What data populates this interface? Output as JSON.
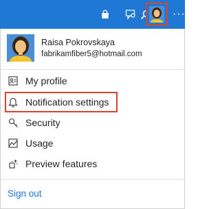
{
  "topbar": {
    "icons": [
      "search-icon",
      "shopping-bag-icon",
      "feedback-icon",
      "avatar",
      "more-icon"
    ],
    "more_glyph": "···"
  },
  "profile": {
    "name": "Raisa Pokrovskaya",
    "email": "fabrikamfiber5@hotmail.com"
  },
  "menu": {
    "items": [
      {
        "label": "My profile",
        "icon": "id-card-icon"
      },
      {
        "label": "Notification settings",
        "icon": "bell-icon"
      },
      {
        "label": "Security",
        "icon": "key-icon"
      },
      {
        "label": "Usage",
        "icon": "usage-icon"
      },
      {
        "label": "Preview features",
        "icon": "preview-features-icon"
      }
    ],
    "sign_out": "Sign out"
  },
  "colors": {
    "topbar_bg": "#1e78d4",
    "highlight_border": "#d9422b",
    "link": "#1e78d4"
  }
}
